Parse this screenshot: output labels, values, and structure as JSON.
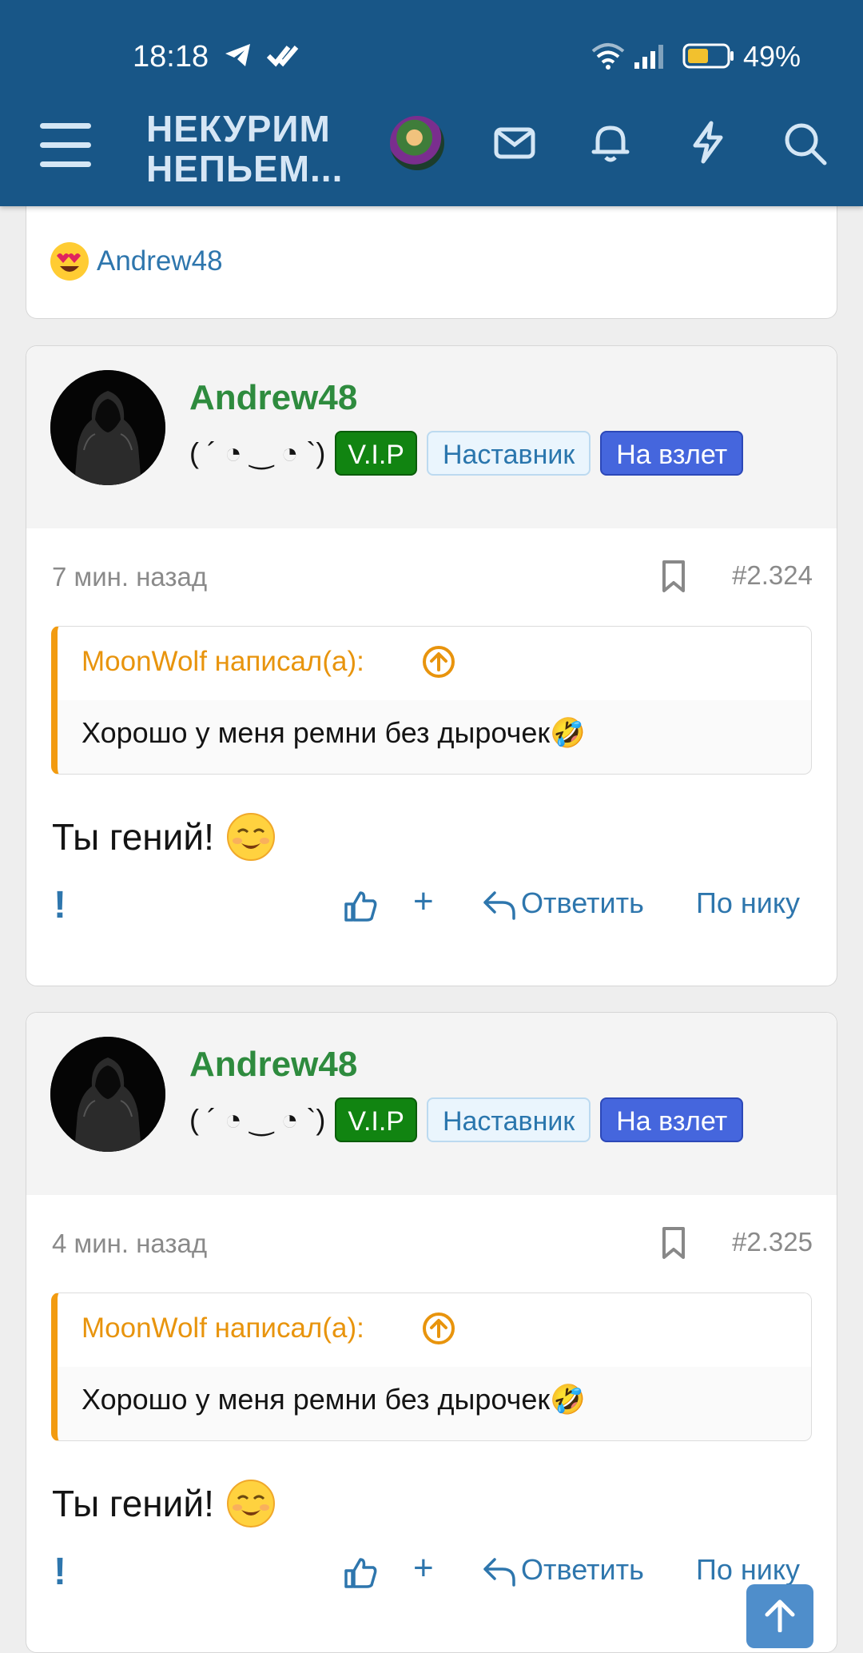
{
  "status_bar": {
    "time": "18:18",
    "battery": "49%"
  },
  "header": {
    "title_line1": "НЕКУРИМ",
    "title_line2": "НЕПЬЕМ...",
    "icons": [
      "menu-icon",
      "avatar",
      "mail-icon",
      "bell-icon",
      "lightning-icon",
      "search-icon"
    ]
  },
  "previous_post": {
    "reaction_user": "Andrew48",
    "reaction_icon": "heart-eyes-emoji"
  },
  "posts": [
    {
      "username": "Andrew48",
      "kaomoji": "( ´ ◔ ‿ ◔ `)",
      "badges": [
        "V.I.P",
        "Наставник",
        "На взлет"
      ],
      "time": "7 мин. назад",
      "number": "#2.324",
      "quote_author": "MoonWolf написал(а):",
      "quote_text": "Хорошо у меня ремни без дырочек🤣",
      "text": "Ты гений!",
      "actions": {
        "report": "!",
        "plus": "+",
        "reply": "Ответить",
        "by_nick": "По нику"
      }
    },
    {
      "username": "Andrew48",
      "kaomoji": "( ´ ◔ ‿ ◔ `)",
      "badges": [
        "V.I.P",
        "Наставник",
        "На взлет"
      ],
      "time": "4 мин. назад",
      "number": "#2.325",
      "quote_author": "MoonWolf написал(а):",
      "quote_text": "Хорошо у меня ремни без дырочек🤣",
      "text": "Ты гений!",
      "actions": {
        "report": "!",
        "plus": "+",
        "reply": "Ответить",
        "by_nick": "По нику"
      }
    }
  ],
  "colors": {
    "header_bg": "#185687",
    "username": "#2e8b3e",
    "link": "#2e76ad",
    "quote_accent": "#f29b10",
    "vip": "#118411",
    "fly": "#4566dd"
  }
}
